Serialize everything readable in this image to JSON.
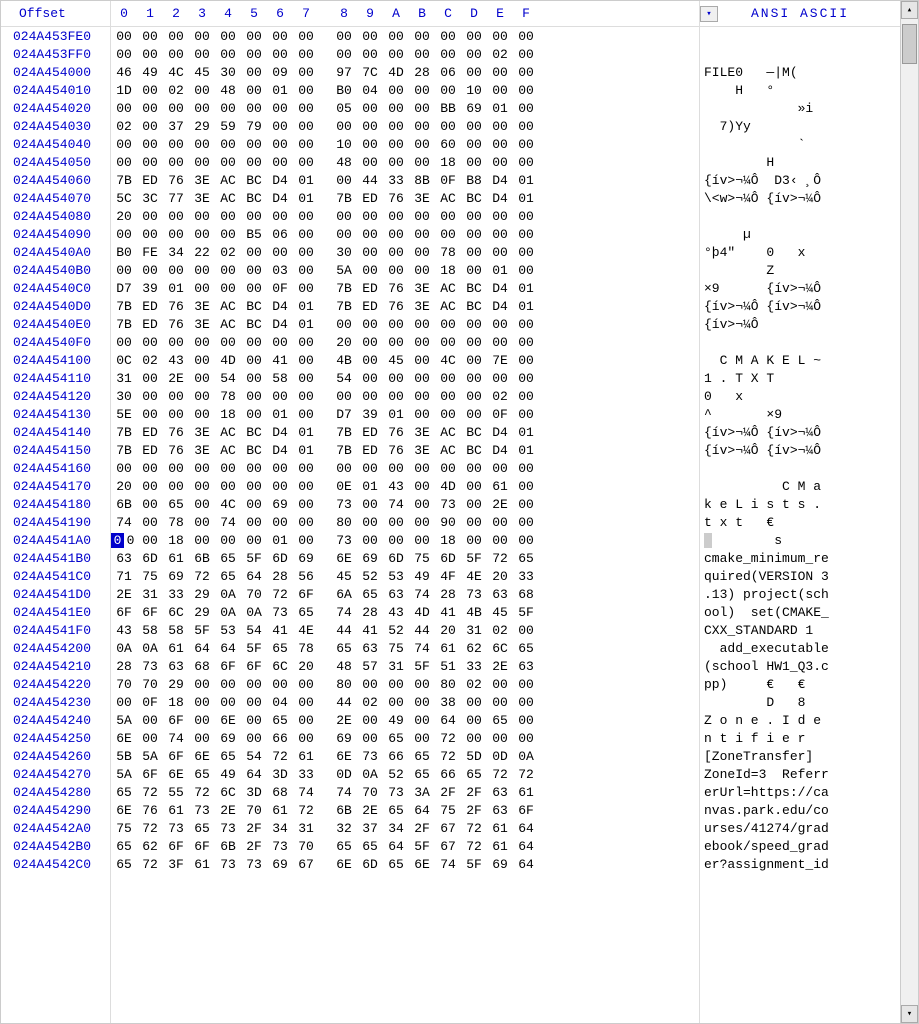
{
  "header": {
    "offset_label": "Offset",
    "hex_cols": [
      "0",
      "1",
      "2",
      "3",
      "4",
      "5",
      "6",
      "7",
      "8",
      "9",
      "A",
      "B",
      "C",
      "D",
      "E",
      "F"
    ],
    "ascii_label": "ANSI ASCII",
    "toggle_glyph": "▾"
  },
  "cursor": {
    "row_index": 13,
    "col_index": 0,
    "ascii_index": 0
  },
  "rows": [
    {
      "offset": "024A453FE0",
      "hex": [
        "00",
        "00",
        "00",
        "00",
        "00",
        "00",
        "00",
        "00",
        "00",
        "00",
        "00",
        "00",
        "00",
        "00",
        "00",
        "00"
      ],
      "ascii": ""
    },
    {
      "offset": "024A453FF0",
      "hex": [
        "00",
        "00",
        "00",
        "00",
        "00",
        "00",
        "00",
        "00",
        "00",
        "00",
        "00",
        "00",
        "00",
        "00",
        "02",
        "00"
      ],
      "ascii": ""
    },
    {
      "offset": "024A454000",
      "hex": [
        "46",
        "49",
        "4C",
        "45",
        "30",
        "00",
        "09",
        "00",
        "97",
        "7C",
        "4D",
        "28",
        "06",
        "00",
        "00",
        "00"
      ],
      "ascii": "FILE0   —|M("
    },
    {
      "offset": "024A454010",
      "hex": [
        "1D",
        "00",
        "02",
        "00",
        "48",
        "00",
        "01",
        "00",
        "B0",
        "04",
        "00",
        "00",
        "00",
        "10",
        "00",
        "00"
      ],
      "ascii": "    H   °"
    },
    {
      "offset": "024A454020",
      "hex": [
        "00",
        "00",
        "00",
        "00",
        "00",
        "00",
        "00",
        "00",
        "05",
        "00",
        "00",
        "00",
        "BB",
        "69",
        "01",
        "00"
      ],
      "ascii": "            »i"
    },
    {
      "offset": "024A454030",
      "hex": [
        "02",
        "00",
        "37",
        "29",
        "59",
        "79",
        "00",
        "00",
        "00",
        "00",
        "00",
        "00",
        "00",
        "00",
        "00",
        "00"
      ],
      "ascii": "  7)Yy"
    },
    {
      "offset": "024A454040",
      "hex": [
        "00",
        "00",
        "00",
        "00",
        "00",
        "00",
        "00",
        "00",
        "10",
        "00",
        "00",
        "00",
        "60",
        "00",
        "00",
        "00"
      ],
      "ascii": "            `"
    },
    {
      "offset": "024A454050",
      "hex": [
        "00",
        "00",
        "00",
        "00",
        "00",
        "00",
        "00",
        "00",
        "48",
        "00",
        "00",
        "00",
        "18",
        "00",
        "00",
        "00"
      ],
      "ascii": "        H"
    },
    {
      "offset": "024A454060",
      "hex": [
        "7B",
        "ED",
        "76",
        "3E",
        "AC",
        "BC",
        "D4",
        "01",
        "00",
        "44",
        "33",
        "8B",
        "0F",
        "B8",
        "D4",
        "01"
      ],
      "ascii": "{ív>¬¼Ô  D3‹ ¸Ô"
    },
    {
      "offset": "024A454070",
      "hex": [
        "5C",
        "3C",
        "77",
        "3E",
        "AC",
        "BC",
        "D4",
        "01",
        "7B",
        "ED",
        "76",
        "3E",
        "AC",
        "BC",
        "D4",
        "01"
      ],
      "ascii": "\\<w>¬¼Ô {ív>¬¼Ô"
    },
    {
      "offset": "024A454080",
      "hex": [
        "20",
        "00",
        "00",
        "00",
        "00",
        "00",
        "00",
        "00",
        "00",
        "00",
        "00",
        "00",
        "00",
        "00",
        "00",
        "00"
      ],
      "ascii": ""
    },
    {
      "offset": "024A454090",
      "hex": [
        "00",
        "00",
        "00",
        "00",
        "00",
        "B5",
        "06",
        "00",
        "00",
        "00",
        "00",
        "00",
        "00",
        "00",
        "00",
        "00"
      ],
      "ascii": "     µ"
    },
    {
      "offset": "024A4540A0",
      "hex": [
        "B0",
        "FE",
        "34",
        "22",
        "02",
        "00",
        "00",
        "00",
        "30",
        "00",
        "00",
        "00",
        "78",
        "00",
        "00",
        "00"
      ],
      "ascii": "°þ4\"    0   x"
    },
    {
      "offset": "024A4540B0",
      "hex": [
        "00",
        "00",
        "00",
        "00",
        "00",
        "00",
        "03",
        "00",
        "5A",
        "00",
        "00",
        "00",
        "18",
        "00",
        "01",
        "00"
      ],
      "ascii": "        Z"
    },
    {
      "offset": "024A4540C0",
      "hex": [
        "D7",
        "39",
        "01",
        "00",
        "00",
        "00",
        "0F",
        "00",
        "7B",
        "ED",
        "76",
        "3E",
        "AC",
        "BC",
        "D4",
        "01"
      ],
      "ascii": "×9      {ív>¬¼Ô"
    },
    {
      "offset": "024A4540D0",
      "hex": [
        "7B",
        "ED",
        "76",
        "3E",
        "AC",
        "BC",
        "D4",
        "01",
        "7B",
        "ED",
        "76",
        "3E",
        "AC",
        "BC",
        "D4",
        "01"
      ],
      "ascii": "{ív>¬¼Ô {ív>¬¼Ô"
    },
    {
      "offset": "024A4540E0",
      "hex": [
        "7B",
        "ED",
        "76",
        "3E",
        "AC",
        "BC",
        "D4",
        "01",
        "00",
        "00",
        "00",
        "00",
        "00",
        "00",
        "00",
        "00"
      ],
      "ascii": "{ív>¬¼Ô"
    },
    {
      "offset": "024A4540F0",
      "hex": [
        "00",
        "00",
        "00",
        "00",
        "00",
        "00",
        "00",
        "00",
        "20",
        "00",
        "00",
        "00",
        "00",
        "00",
        "00",
        "00"
      ],
      "ascii": ""
    },
    {
      "offset": "024A454100",
      "hex": [
        "0C",
        "02",
        "43",
        "00",
        "4D",
        "00",
        "41",
        "00",
        "4B",
        "00",
        "45",
        "00",
        "4C",
        "00",
        "7E",
        "00"
      ],
      "ascii": "  C M A K E L ~"
    },
    {
      "offset": "024A454110",
      "hex": [
        "31",
        "00",
        "2E",
        "00",
        "54",
        "00",
        "58",
        "00",
        "54",
        "00",
        "00",
        "00",
        "00",
        "00",
        "00",
        "00"
      ],
      "ascii": "1 . T X T"
    },
    {
      "offset": "024A454120",
      "hex": [
        "30",
        "00",
        "00",
        "00",
        "78",
        "00",
        "00",
        "00",
        "00",
        "00",
        "00",
        "00",
        "00",
        "00",
        "02",
        "00"
      ],
      "ascii": "0   x"
    },
    {
      "offset": "024A454130",
      "hex": [
        "5E",
        "00",
        "00",
        "00",
        "18",
        "00",
        "01",
        "00",
        "D7",
        "39",
        "01",
        "00",
        "00",
        "00",
        "0F",
        "00"
      ],
      "ascii": "^       ×9"
    },
    {
      "offset": "024A454140",
      "hex": [
        "7B",
        "ED",
        "76",
        "3E",
        "AC",
        "BC",
        "D4",
        "01",
        "7B",
        "ED",
        "76",
        "3E",
        "AC",
        "BC",
        "D4",
        "01"
      ],
      "ascii": "{ív>¬¼Ô {ív>¬¼Ô"
    },
    {
      "offset": "024A454150",
      "hex": [
        "7B",
        "ED",
        "76",
        "3E",
        "AC",
        "BC",
        "D4",
        "01",
        "7B",
        "ED",
        "76",
        "3E",
        "AC",
        "BC",
        "D4",
        "01"
      ],
      "ascii": "{ív>¬¼Ô {ív>¬¼Ô"
    },
    {
      "offset": "024A454160",
      "hex": [
        "00",
        "00",
        "00",
        "00",
        "00",
        "00",
        "00",
        "00",
        "00",
        "00",
        "00",
        "00",
        "00",
        "00",
        "00",
        "00"
      ],
      "ascii": ""
    },
    {
      "offset": "024A454170",
      "hex": [
        "20",
        "00",
        "00",
        "00",
        "00",
        "00",
        "00",
        "00",
        "0E",
        "01",
        "43",
        "00",
        "4D",
        "00",
        "61",
        "00"
      ],
      "ascii": "          C M a"
    },
    {
      "offset": "024A454180",
      "hex": [
        "6B",
        "00",
        "65",
        "00",
        "4C",
        "00",
        "69",
        "00",
        "73",
        "00",
        "74",
        "00",
        "73",
        "00",
        "2E",
        "00"
      ],
      "ascii": "k e L i s t s ."
    },
    {
      "offset": "024A454190",
      "hex": [
        "74",
        "00",
        "78",
        "00",
        "74",
        "00",
        "00",
        "00",
        "80",
        "00",
        "00",
        "00",
        "90",
        "00",
        "00",
        "00"
      ],
      "ascii": "t x t   €"
    },
    {
      "offset": "024A4541A0",
      "hex": [
        "00",
        "00",
        "18",
        "00",
        "00",
        "00",
        "01",
        "00",
        "73",
        "00",
        "00",
        "00",
        "18",
        "00",
        "00",
        "00"
      ],
      "ascii": "        s"
    },
    {
      "offset": "024A4541B0",
      "hex": [
        "63",
        "6D",
        "61",
        "6B",
        "65",
        "5F",
        "6D",
        "69",
        "6E",
        "69",
        "6D",
        "75",
        "6D",
        "5F",
        "72",
        "65"
      ],
      "ascii": "cmake_minimum_re"
    },
    {
      "offset": "024A4541C0",
      "hex": [
        "71",
        "75",
        "69",
        "72",
        "65",
        "64",
        "28",
        "56",
        "45",
        "52",
        "53",
        "49",
        "4F",
        "4E",
        "20",
        "33"
      ],
      "ascii": "quired(VERSION 3"
    },
    {
      "offset": "024A4541D0",
      "hex": [
        "2E",
        "31",
        "33",
        "29",
        "0A",
        "70",
        "72",
        "6F",
        "6A",
        "65",
        "63",
        "74",
        "28",
        "73",
        "63",
        "68"
      ],
      "ascii": ".13) project(sch"
    },
    {
      "offset": "024A4541E0",
      "hex": [
        "6F",
        "6F",
        "6C",
        "29",
        "0A",
        "0A",
        "73",
        "65",
        "74",
        "28",
        "43",
        "4D",
        "41",
        "4B",
        "45",
        "5F"
      ],
      "ascii": "ool)  set(CMAKE_"
    },
    {
      "offset": "024A4541F0",
      "hex": [
        "43",
        "58",
        "58",
        "5F",
        "53",
        "54",
        "41",
        "4E",
        "44",
        "41",
        "52",
        "44",
        "20",
        "31",
        "02",
        "00"
      ],
      "ascii": "CXX_STANDARD 1"
    },
    {
      "offset": "024A454200",
      "hex": [
        "0A",
        "0A",
        "61",
        "64",
        "64",
        "5F",
        "65",
        "78",
        "65",
        "63",
        "75",
        "74",
        "61",
        "62",
        "6C",
        "65"
      ],
      "ascii": "  add_executable"
    },
    {
      "offset": "024A454210",
      "hex": [
        "28",
        "73",
        "63",
        "68",
        "6F",
        "6F",
        "6C",
        "20",
        "48",
        "57",
        "31",
        "5F",
        "51",
        "33",
        "2E",
        "63"
      ],
      "ascii": "(school HW1_Q3.c"
    },
    {
      "offset": "024A454220",
      "hex": [
        "70",
        "70",
        "29",
        "00",
        "00",
        "00",
        "00",
        "00",
        "80",
        "00",
        "00",
        "00",
        "80",
        "02",
        "00",
        "00"
      ],
      "ascii": "pp)     €   €"
    },
    {
      "offset": "024A454230",
      "hex": [
        "00",
        "0F",
        "18",
        "00",
        "00",
        "00",
        "04",
        "00",
        "44",
        "02",
        "00",
        "00",
        "38",
        "00",
        "00",
        "00"
      ],
      "ascii": "        D   8"
    },
    {
      "offset": "024A454240",
      "hex": [
        "5A",
        "00",
        "6F",
        "00",
        "6E",
        "00",
        "65",
        "00",
        "2E",
        "00",
        "49",
        "00",
        "64",
        "00",
        "65",
        "00"
      ],
      "ascii": "Z o n e . I d e"
    },
    {
      "offset": "024A454250",
      "hex": [
        "6E",
        "00",
        "74",
        "00",
        "69",
        "00",
        "66",
        "00",
        "69",
        "00",
        "65",
        "00",
        "72",
        "00",
        "00",
        "00"
      ],
      "ascii": "n t i f i e r"
    },
    {
      "offset": "024A454260",
      "hex": [
        "5B",
        "5A",
        "6F",
        "6E",
        "65",
        "54",
        "72",
        "61",
        "6E",
        "73",
        "66",
        "65",
        "72",
        "5D",
        "0D",
        "0A"
      ],
      "ascii": "[ZoneTransfer]"
    },
    {
      "offset": "024A454270",
      "hex": [
        "5A",
        "6F",
        "6E",
        "65",
        "49",
        "64",
        "3D",
        "33",
        "0D",
        "0A",
        "52",
        "65",
        "66",
        "65",
        "72",
        "72"
      ],
      "ascii": "ZoneId=3  Referr"
    },
    {
      "offset": "024A454280",
      "hex": [
        "65",
        "72",
        "55",
        "72",
        "6C",
        "3D",
        "68",
        "74",
        "74",
        "70",
        "73",
        "3A",
        "2F",
        "2F",
        "63",
        "61"
      ],
      "ascii": "erUrl=https://ca"
    },
    {
      "offset": "024A454290",
      "hex": [
        "6E",
        "76",
        "61",
        "73",
        "2E",
        "70",
        "61",
        "72",
        "6B",
        "2E",
        "65",
        "64",
        "75",
        "2F",
        "63",
        "6F"
      ],
      "ascii": "nvas.park.edu/co"
    },
    {
      "offset": "024A4542A0",
      "hex": [
        "75",
        "72",
        "73",
        "65",
        "73",
        "2F",
        "34",
        "31",
        "32",
        "37",
        "34",
        "2F",
        "67",
        "72",
        "61",
        "64"
      ],
      "ascii": "urses/41274/grad"
    },
    {
      "offset": "024A4542B0",
      "hex": [
        "65",
        "62",
        "6F",
        "6F",
        "6B",
        "2F",
        "73",
        "70",
        "65",
        "65",
        "64",
        "5F",
        "67",
        "72",
        "61",
        "64"
      ],
      "ascii": "ebook/speed_grad"
    },
    {
      "offset": "024A4542C0",
      "hex": [
        "65",
        "72",
        "3F",
        "61",
        "73",
        "73",
        "69",
        "67",
        "6E",
        "6D",
        "65",
        "6E",
        "74",
        "5F",
        "69",
        "64"
      ],
      "ascii": "er?assignment_id"
    }
  ]
}
